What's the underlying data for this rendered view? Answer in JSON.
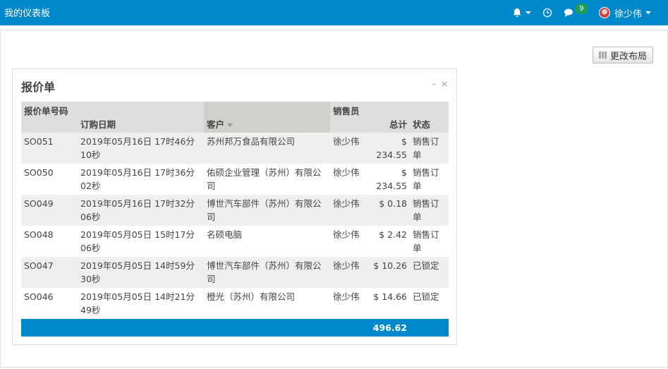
{
  "app": {
    "title": "我的仪表板"
  },
  "nav": {
    "notifications_badge": "9",
    "user_name": "徐少伟"
  },
  "toolbar": {
    "change_layout_label": "更改布局"
  },
  "panel": {
    "title": "报价单",
    "controls": "- ×",
    "columns": {
      "order_no": "报价单号码",
      "order_date": "订购日期",
      "customer": "客户",
      "salesperson": "销售员",
      "total": "总计",
      "status": "状态"
    },
    "rows": [
      {
        "order_no": "SO051",
        "date": "2019年05月16日 17时46分10秒",
        "customer": "苏州邦万食品有限公司",
        "salesperson": "徐少伟",
        "total": "$ 234.55",
        "status": "销售订单"
      },
      {
        "order_no": "SO050",
        "date": "2019年05月16日 17时36分02秒",
        "customer": "佑硕企业管理（苏州）有限公司",
        "salesperson": "徐少伟",
        "total": "$ 234.55",
        "status": "销售订单"
      },
      {
        "order_no": "SO049",
        "date": "2019年05月16日 17时32分06秒",
        "customer": "博世汽车部件（苏州）有限公司",
        "salesperson": "徐少伟",
        "total": "$ 0.18",
        "status": "销售订单"
      },
      {
        "order_no": "SO048",
        "date": "2019年05月05日 15时17分06秒",
        "customer": "名硕电脑",
        "salesperson": "徐少伟",
        "total": "$ 2.42",
        "status": "销售订单"
      },
      {
        "order_no": "SO047",
        "date": "2019年05月05日 14时59分30秒",
        "customer": "博世汽车部件（苏州）有限公司",
        "salesperson": "徐少伟",
        "total": "$ 10.26",
        "status": "已锁定"
      },
      {
        "order_no": "SO046",
        "date": "2019年05月05日 14时21分49秒",
        "customer": "橙光（苏州）有限公司",
        "salesperson": "徐少伟",
        "total": "$ 14.66",
        "status": "已锁定"
      }
    ],
    "footer_total": "496.62"
  },
  "colors": {
    "accent": "#0088cc",
    "badge": "#1b9e5a"
  }
}
